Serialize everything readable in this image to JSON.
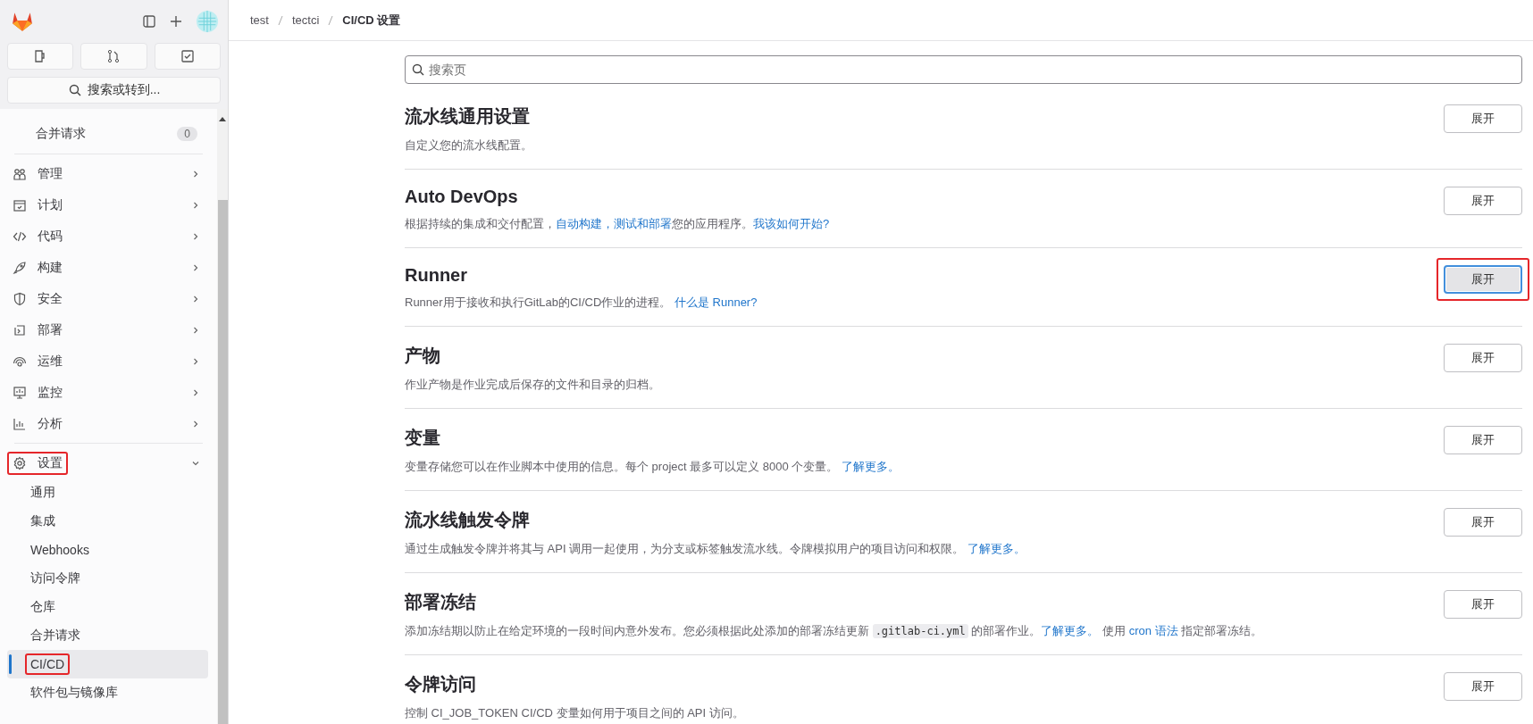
{
  "sidebar": {
    "search_button": "搜索或转到...",
    "top_item": {
      "label": "合并请求",
      "badge": "0"
    },
    "groups": [
      {
        "label": "管理",
        "expanded": false,
        "annotated": false
      },
      {
        "label": "计划",
        "expanded": false,
        "annotated": false
      },
      {
        "label": "代码",
        "expanded": false,
        "annotated": false
      },
      {
        "label": "构建",
        "expanded": false,
        "annotated": false
      },
      {
        "label": "安全",
        "expanded": false,
        "annotated": false
      },
      {
        "label": "部署",
        "expanded": false,
        "annotated": false
      },
      {
        "label": "运维",
        "expanded": false,
        "annotated": false
      },
      {
        "label": "监控",
        "expanded": false,
        "annotated": false
      },
      {
        "label": "分析",
        "expanded": false,
        "annotated": false
      },
      {
        "label": "设置",
        "expanded": true,
        "annotated": true,
        "children": [
          {
            "label": "通用",
            "selected": false,
            "annotated": false
          },
          {
            "label": "集成",
            "selected": false,
            "annotated": false
          },
          {
            "label": "Webhooks",
            "selected": false,
            "annotated": false
          },
          {
            "label": "访问令牌",
            "selected": false,
            "annotated": false
          },
          {
            "label": "仓库",
            "selected": false,
            "annotated": false
          },
          {
            "label": "合并请求",
            "selected": false,
            "annotated": false
          },
          {
            "label": "CI/CD",
            "selected": true,
            "annotated": true
          },
          {
            "label": "软件包与镜像库",
            "selected": false,
            "annotated": false
          }
        ]
      }
    ]
  },
  "breadcrumb": [
    "test",
    "tectci",
    "CI/CD 设置"
  ],
  "search": {
    "placeholder": "搜索页"
  },
  "sections": [
    {
      "title": "流水线通用设置",
      "description": [
        {
          "kind": "text",
          "text": "自定义您的流水线配置。"
        }
      ],
      "button": {
        "label": "展开",
        "focused": false,
        "annotated": false
      }
    },
    {
      "title": "Auto DevOps",
      "description": [
        {
          "kind": "text",
          "text": "根据持续的集成和交付配置，"
        },
        {
          "kind": "link",
          "text": "自动构建，测试和部署"
        },
        {
          "kind": "text",
          "text": "您的应用程序。"
        },
        {
          "kind": "link",
          "text": "我该如何开始?"
        }
      ],
      "button": {
        "label": "展开",
        "focused": false,
        "annotated": false
      }
    },
    {
      "title": "Runner",
      "description": [
        {
          "kind": "text",
          "text": "Runner用于接收和执行GitLab的CI/CD作业的进程。 "
        },
        {
          "kind": "link",
          "text": "什么是 Runner?"
        }
      ],
      "button": {
        "label": "展开",
        "focused": true,
        "annotated": true
      }
    },
    {
      "title": "产物",
      "description": [
        {
          "kind": "text",
          "text": "作业产物是作业完成后保存的文件和目录的归档。"
        }
      ],
      "button": {
        "label": "展开",
        "focused": false,
        "annotated": false
      }
    },
    {
      "title": "变量",
      "description": [
        {
          "kind": "text",
          "text": "变量存储您可以在作业脚本中使用的信息。每个 project 最多可以定义 8000 个变量。 "
        },
        {
          "kind": "link",
          "text": "了解更多。"
        }
      ],
      "button": {
        "label": "展开",
        "focused": false,
        "annotated": false
      }
    },
    {
      "title": "流水线触发令牌",
      "description": [
        {
          "kind": "text",
          "text": "通过生成触发令牌并将其与 API 调用一起使用，为分支或标签触发流水线。令牌模拟用户的项目访问和权限。 "
        },
        {
          "kind": "link",
          "text": "了解更多。"
        }
      ],
      "button": {
        "label": "展开",
        "focused": false,
        "annotated": false
      }
    },
    {
      "title": "部署冻结",
      "description": [
        {
          "kind": "text",
          "text": "添加冻结期以防止在给定环境的一段时间内意外发布。您必须根据此处添加的部署冻结更新 "
        },
        {
          "kind": "code",
          "text": ".gitlab-ci.yml"
        },
        {
          "kind": "text",
          "text": " 的部署作业。"
        },
        {
          "kind": "link",
          "text": "了解更多。"
        },
        {
          "kind": "text",
          "text": " 使用 "
        },
        {
          "kind": "link",
          "text": "cron 语法"
        },
        {
          "kind": "text",
          "text": " 指定部署冻结。"
        }
      ],
      "button": {
        "label": "展开",
        "focused": false,
        "annotated": false
      }
    },
    {
      "title": "令牌访问",
      "description": [
        {
          "kind": "text",
          "text": "控制 CI_JOB_TOKEN CI/CD 变量如何用于项目之间的 API 访问。"
        }
      ],
      "button": {
        "label": "展开",
        "focused": false,
        "annotated": false
      }
    }
  ]
}
